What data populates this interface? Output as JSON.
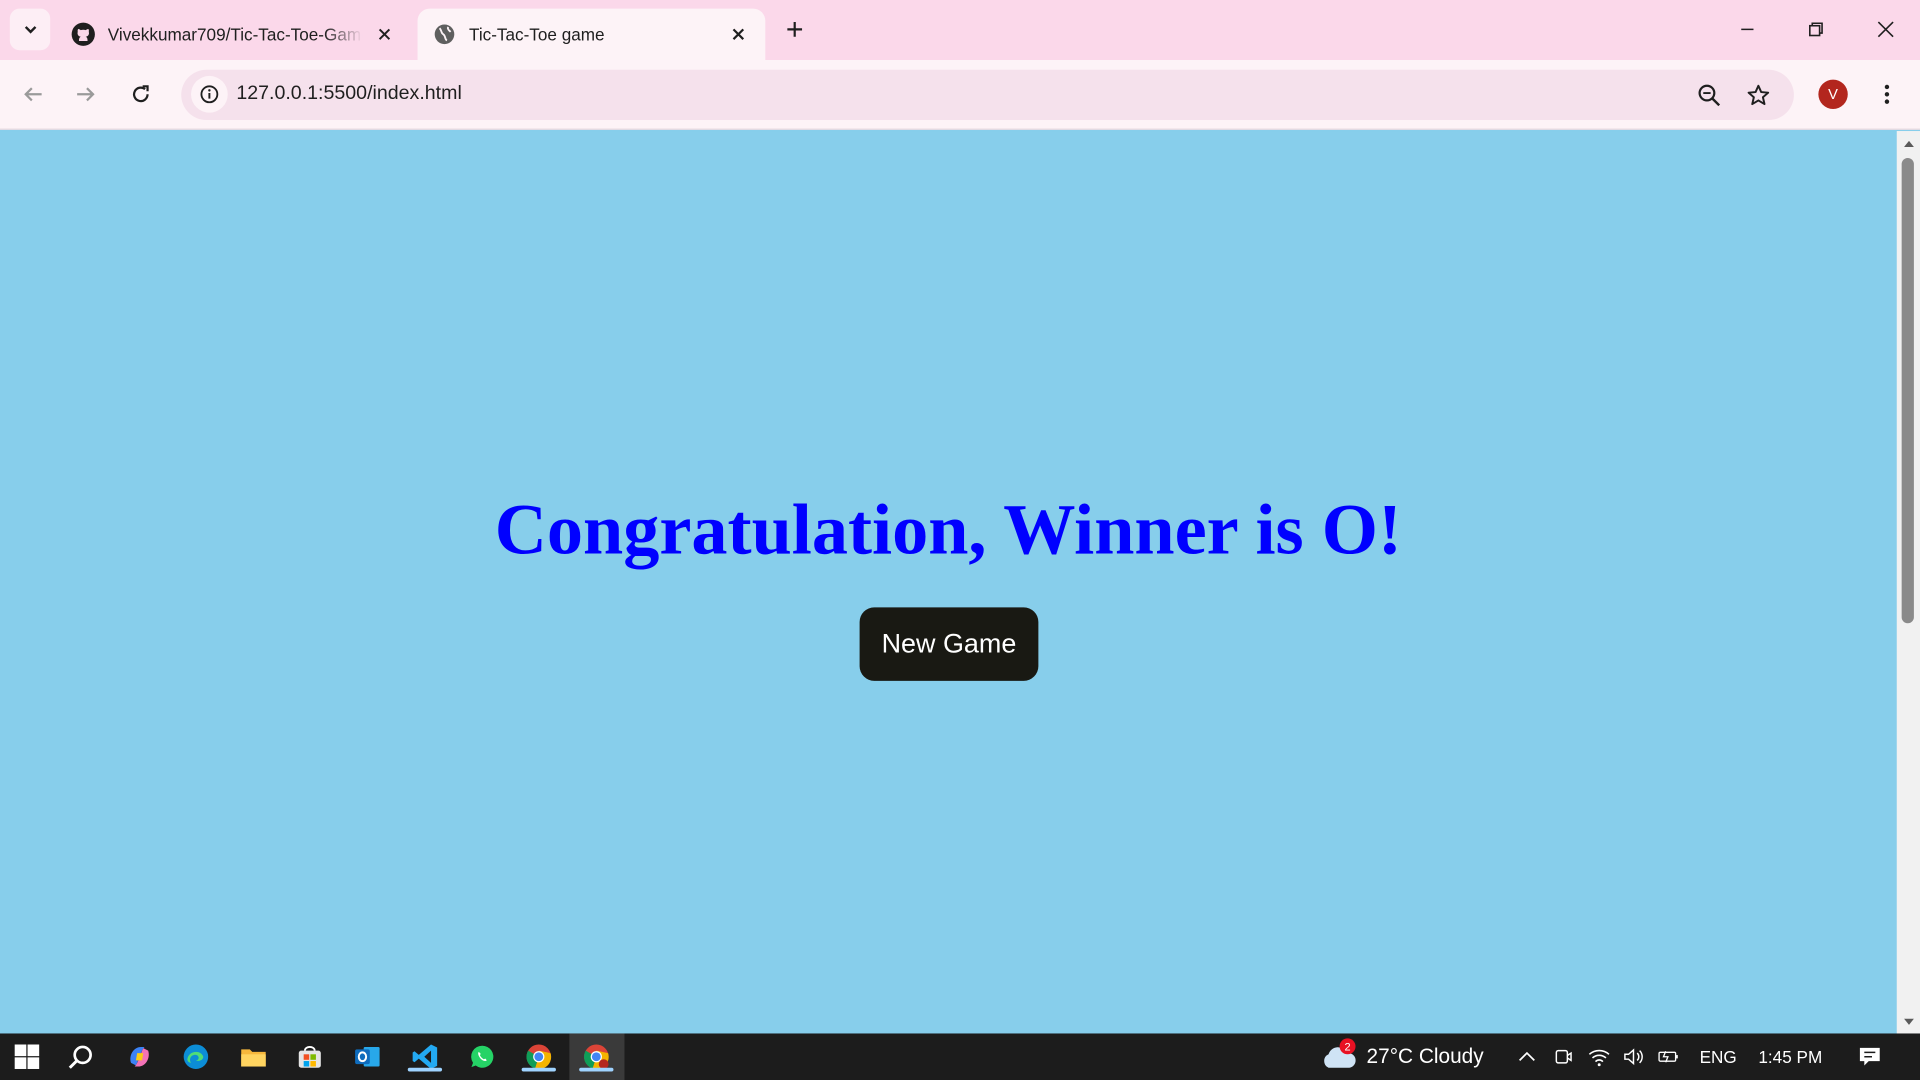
{
  "browser": {
    "tabs": [
      {
        "title": "Vivekkumar709/Tic-Tac-Toe-Game",
        "active": false,
        "favicon": "github-icon"
      },
      {
        "title": "Tic-Tac-Toe game",
        "active": true,
        "favicon": "globe-icon"
      }
    ],
    "url": "127.0.0.1:5500/index.html",
    "profile_initial": "V"
  },
  "page": {
    "background": "#87CEEB",
    "message": "Congratulation, Winner is O!",
    "message_color": "#0000FF",
    "new_game_label": "New Game"
  },
  "taskbar": {
    "apps": [
      "windows-start-icon",
      "search-icon",
      "copilot-icon",
      "edge-icon",
      "file-explorer-icon",
      "microsoft-store-icon",
      "outlook-icon",
      "vscode-icon",
      "whatsapp-icon",
      "chrome-icon",
      "chrome-profile-icon"
    ],
    "weather_badge": "2",
    "weather": "27°C  Cloudy",
    "language": "ENG",
    "time": "1:45 PM"
  }
}
